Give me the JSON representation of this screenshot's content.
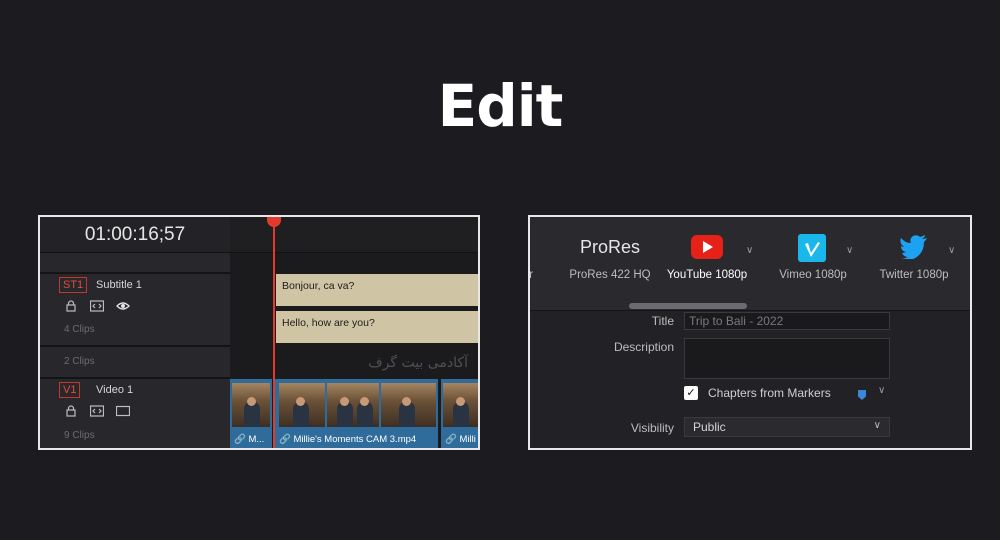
{
  "headline": "Edit",
  "timeline": {
    "timecode": "01:00:16;57",
    "subtitle_track": {
      "tag": "ST1",
      "name": "Subtitle 1",
      "clip_count": "4 Clips"
    },
    "between_count": "2 Clips",
    "video_track": {
      "tag": "V1",
      "name": "Video 1",
      "clip_count": "9 Clips"
    },
    "subtitle_clips": [
      "Bonjour, ca va?",
      "Hello, how are you?"
    ],
    "watermark": "آکادمی بیت گرف",
    "video_clips": [
      "M...",
      "Millie's Moments CAM 3.mp4",
      "Milli"
    ]
  },
  "export": {
    "presets": [
      {
        "name": "er",
        "label": "er",
        "icon": "none"
      },
      {
        "name": "prores",
        "label": "ProRes 422 HQ",
        "icon_text": "ProRes"
      },
      {
        "name": "youtube",
        "label": "YouTube 1080p",
        "icon": "youtube-icon",
        "color": "#e62117"
      },
      {
        "name": "vimeo",
        "label": "Vimeo 1080p",
        "icon": "vimeo-icon",
        "color": "#1ab7ea"
      },
      {
        "name": "twitter",
        "label": "Twitter 1080p",
        "icon": "twitter-icon",
        "color": "#1da1f2"
      }
    ],
    "form": {
      "title_label": "Title",
      "title_value": "Trip to Bali - 2022",
      "description_label": "Description",
      "description_value": "",
      "chapters_label": "Chapters from Markers",
      "chapters_checked": true,
      "visibility_label": "Visibility",
      "visibility_value": "Public"
    }
  },
  "colors": {
    "playhead": "#e23b2d",
    "subtitle_clip": "#cfc4a4",
    "video_clip": "#2f6c9b"
  }
}
